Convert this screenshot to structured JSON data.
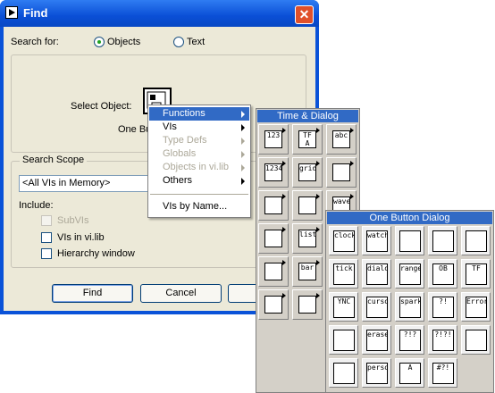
{
  "window": {
    "title": "Find",
    "close_glyph": "✕"
  },
  "search_for": {
    "label": "Search for:",
    "options": [
      {
        "label": "Objects",
        "selected": true
      },
      {
        "label": "Text",
        "selected": false
      }
    ]
  },
  "select_object": {
    "label": "Select Object:",
    "caption": "One Bu"
  },
  "search_scope": {
    "legend": "Search Scope",
    "value": "<All VIs in Memory>"
  },
  "include": {
    "label": "Include:",
    "items": [
      {
        "label": "SubVIs",
        "checked": false,
        "enabled": false
      },
      {
        "label": "VIs in vi.lib",
        "checked": false,
        "enabled": true
      },
      {
        "label": "Hierarchy window",
        "checked": false,
        "enabled": true
      }
    ]
  },
  "buttons": {
    "find": "Find",
    "cancel": "Cancel"
  },
  "context_menu": {
    "items": [
      {
        "label": "Functions",
        "highlighted": true,
        "submenu": true,
        "enabled": true
      },
      {
        "label": "VIs",
        "submenu": true,
        "enabled": true
      },
      {
        "label": "Type Defs",
        "submenu": true,
        "enabled": false
      },
      {
        "label": "Globals",
        "submenu": true,
        "enabled": false
      },
      {
        "label": "Objects in vi.lib",
        "submenu": true,
        "enabled": false
      },
      {
        "label": "Others",
        "submenu": true,
        "enabled": true
      }
    ],
    "footer_item": "VIs by Name..."
  },
  "time_dialog_palette": {
    "title": "Time & Dialog",
    "icons": [
      "123",
      "TF A",
      "abc",
      "1234",
      "grid",
      "arrow",
      "timer",
      "dialog",
      "wave",
      "tools",
      "list",
      "file",
      "chart",
      "bar",
      "multi",
      "print",
      "shapes",
      "doc"
    ]
  },
  "one_button_palette": {
    "title": "One Button Dialog",
    "icons": [
      "clock",
      "watch",
      "metronome",
      "calendar",
      "1/89 10:21",
      "tick",
      "dialog",
      "range",
      "OB",
      "TF",
      "YNC",
      "cursor",
      "spark",
      "?!",
      "Error",
      "Error +",
      "eraser",
      "?!?",
      "?!?!",
      "hourglass",
      "stopwatch",
      "person",
      "A",
      "#?!"
    ]
  },
  "colors": {
    "title_bar": "#0a52d8",
    "menu_highlight": "#316ac5",
    "dialog_bg": "#ece9d8"
  }
}
